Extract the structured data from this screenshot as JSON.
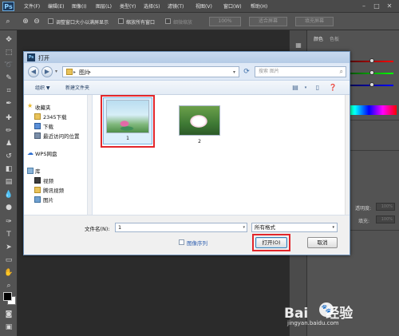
{
  "app": {
    "logo": "Ps",
    "menus": [
      "文件(F)",
      "编辑(E)",
      "图像(I)",
      "图层(L)",
      "类型(Y)",
      "选择(S)",
      "滤镜(T)",
      "视图(V)",
      "窗口(W)",
      "帮助(H)"
    ]
  },
  "options_bar": {
    "resize_windows_label": "调整窗口大小以满屏显示",
    "zoom_all_label": "缩放所有窗口",
    "scrubby_zoom_label": "细微缩放",
    "zoom_100_label": "100%",
    "fit_screen_label": "适合屏幕",
    "fill_screen_label": "填充屏幕"
  },
  "right_panel": {
    "tab_color": "颜色",
    "tab_swatches": "色板",
    "opacity_label": "透明度:",
    "opacity_value": "100%",
    "fill_label": "填充:",
    "fill_value": "100%"
  },
  "dialog": {
    "title": "打开",
    "breadcrumb": "图片",
    "search_placeholder": "搜索 图片",
    "organize_label": "组织 ▼",
    "new_folder_label": "新建文件夹",
    "nav": {
      "favorites": "收藏夹",
      "item_2345": "2345下载",
      "item_downloads": "下载",
      "item_recent": "最近访问的位置",
      "wps_cloud": "WPS网盘",
      "libraries": "库",
      "lib_videos": "视频",
      "lib_tencent": "腾讯视频",
      "lib_pictures": "图片"
    },
    "files": [
      {
        "name": "1",
        "selected": true
      },
      {
        "name": "2",
        "selected": false
      }
    ],
    "filename_label": "文件名(N):",
    "filename_value": "1",
    "filetype_value": "所有格式",
    "image_sequence_label": "图像序列",
    "open_button": "打开(O)",
    "cancel_button": "取消"
  },
  "watermark": {
    "logo_text_left": "Bai",
    "logo_text_right": "经验",
    "url": "jingyan.baidu.com"
  },
  "colors": {
    "highlight_red": "#e2262a",
    "selection_blue": "#7fb5e0"
  }
}
